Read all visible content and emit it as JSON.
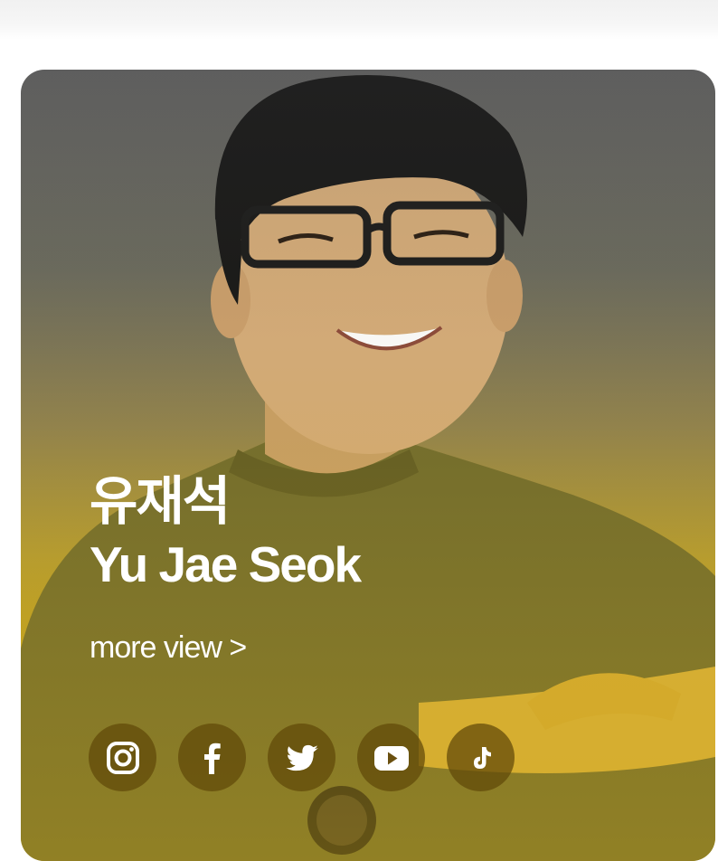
{
  "profile": {
    "name_ko": "유재석",
    "name_en": "Yu Jae Seok",
    "more_label": "more view >"
  },
  "socials": [
    {
      "icon": "instagram-icon"
    },
    {
      "icon": "facebook-icon"
    },
    {
      "icon": "twitter-icon"
    },
    {
      "icon": "youtube-icon"
    },
    {
      "icon": "tiktok-icon"
    }
  ],
  "colors": {
    "card_top": "#5f5f5f",
    "card_bottom": "#d4ab12",
    "social_bg": "#5f4808",
    "text": "#ffffff"
  }
}
